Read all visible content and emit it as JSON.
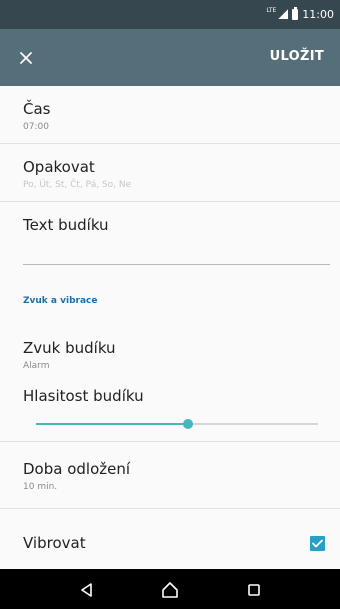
{
  "status_bar": {
    "network": "LTE",
    "time": "11:00"
  },
  "app_bar": {
    "close_icon": "close-icon",
    "save_label": "ULOŽIT",
    "color": "#546e7a"
  },
  "settings": {
    "time": {
      "title": "Čas",
      "value": "07:00"
    },
    "repeat": {
      "title": "Opakovat",
      "value": "Po, Út, St, Čt, Pá, So, Ne"
    },
    "alarm_text": {
      "title": "Text budíku",
      "value": ""
    },
    "sound_section": {
      "header": "Zvuk a vibrace"
    },
    "alarm_sound": {
      "title": "Zvuk budíku",
      "value": "Alarm"
    },
    "volume": {
      "title": "Hlasitost budíku",
      "level": 0.54
    },
    "snooze": {
      "title": "Doba odložení",
      "value": "10 min."
    },
    "vibrate": {
      "title": "Vibrovat",
      "checked": true
    }
  },
  "accent_color": "#45b7bb",
  "nav_bar": {
    "back_icon": "back-icon",
    "home_icon": "home-icon",
    "recents_icon": "recents-icon"
  }
}
